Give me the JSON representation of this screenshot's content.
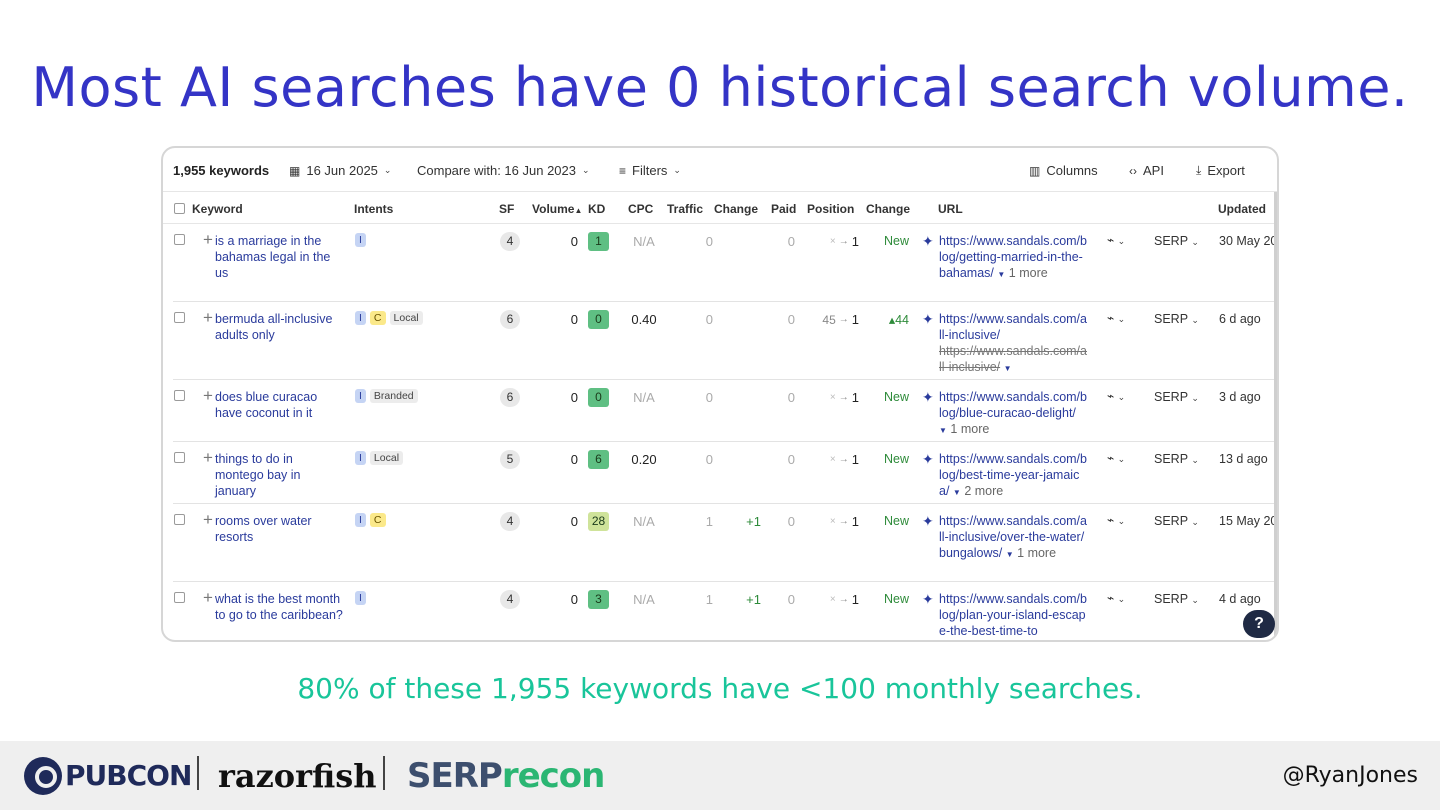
{
  "slide": {
    "title": "Most AI searches have 0 historical search volume.",
    "subtitle": "80% of these 1,955 keywords have <100 monthly searches.",
    "handle": "@RyanJones"
  },
  "logos": {
    "pubcon": "PUBCON",
    "razorfish": "razorfish",
    "serprecon_a": "SERP",
    "serprecon_b": "recon"
  },
  "toolbar": {
    "count": "1,955 keywords",
    "date": "16 Jun 2025",
    "compare": "Compare with: 16 Jun 2023",
    "filters": "Filters",
    "columns": "Columns",
    "api": "API",
    "export": "Export"
  },
  "columns": {
    "keyword": "Keyword",
    "intents": "Intents",
    "sf": "SF",
    "volume": "Volume",
    "kd": "KD",
    "cpc": "CPC",
    "traffic": "Traffic",
    "change": "Change",
    "paid": "Paid",
    "position": "Position",
    "change2": "Change",
    "url": "URL",
    "updated": "Updated"
  },
  "rows": [
    {
      "keyword": "is a marriage in the bahamas legal in the us",
      "intents": [
        "I"
      ],
      "tags": [],
      "sf": "4",
      "volume": "0",
      "kd": "1",
      "kd_color": "#5fbf83",
      "cpc": "N/A",
      "traffic": "0",
      "change": "",
      "paid": "0",
      "pos_from": "×",
      "position": "1",
      "change2": "New",
      "url": "https://www.sandals.com/blog/getting-married-in-the-bahamas/",
      "url_strike": "",
      "more": "1 more",
      "serp": "SERP",
      "updated": "30 May 20"
    },
    {
      "keyword": "bermuda all-inclusive adults only",
      "intents": [
        "I",
        "C"
      ],
      "tags": [
        "Local"
      ],
      "sf": "6",
      "volume": "0",
      "kd": "0",
      "kd_color": "#5fbf83",
      "cpc": "0.40",
      "traffic": "0",
      "change": "",
      "paid": "0",
      "pos_from": "45",
      "position": "1",
      "change2": "▴44",
      "url": "https://www.sandals.com/all-inclusive/",
      "url_strike": "https://www.sandals.com/all-inclusive/",
      "more": "",
      "serp": "SERP",
      "updated": "6 d ago"
    },
    {
      "keyword": "does blue curacao have coconut in it",
      "intents": [
        "I"
      ],
      "tags": [
        "Branded"
      ],
      "sf": "6",
      "volume": "0",
      "kd": "0",
      "kd_color": "#5fbf83",
      "cpc": "N/A",
      "traffic": "0",
      "change": "",
      "paid": "0",
      "pos_from": "×",
      "position": "1",
      "change2": "New",
      "url": "https://www.sandals.com/blog/blue-curacao-delight/",
      "url_strike": "",
      "more": "1 more",
      "serp": "SERP",
      "updated": "3 d ago"
    },
    {
      "keyword": "things to do in montego bay in january",
      "intents": [
        "I"
      ],
      "tags": [
        "Local"
      ],
      "sf": "5",
      "volume": "0",
      "kd": "6",
      "kd_color": "#5fbf83",
      "cpc": "0.20",
      "traffic": "0",
      "change": "",
      "paid": "0",
      "pos_from": "×",
      "position": "1",
      "change2": "New",
      "url": "https://www.sandals.com/blog/best-time-year-jamaica/",
      "url_strike": "",
      "more": "2 more",
      "serp": "SERP",
      "updated": "13 d ago"
    },
    {
      "keyword": "rooms over water resorts",
      "intents": [
        "I",
        "C"
      ],
      "tags": [],
      "sf": "4",
      "volume": "0",
      "kd": "28",
      "kd_color": "#cfe39a",
      "cpc": "N/A",
      "traffic": "1",
      "change": "+1",
      "paid": "0",
      "pos_from": "×",
      "position": "1",
      "change2": "New",
      "url": "https://www.sandals.com/all-inclusive/over-the-water/bungalows/",
      "url_strike": "",
      "more": "1 more",
      "serp": "SERP",
      "updated": "15 May 20"
    },
    {
      "keyword": "what is the best month to go to the caribbean?",
      "intents": [
        "I"
      ],
      "tags": [],
      "sf": "4",
      "volume": "0",
      "kd": "3",
      "kd_color": "#5fbf83",
      "cpc": "N/A",
      "traffic": "1",
      "change": "+1",
      "paid": "0",
      "pos_from": "×",
      "position": "1",
      "change2": "New",
      "url": "https://www.sandals.com/blog/plan-your-island-escape-the-best-time-to",
      "url_strike": "",
      "more": "",
      "serp": "SERP",
      "updated": "4 d ago"
    }
  ],
  "help": "?"
}
